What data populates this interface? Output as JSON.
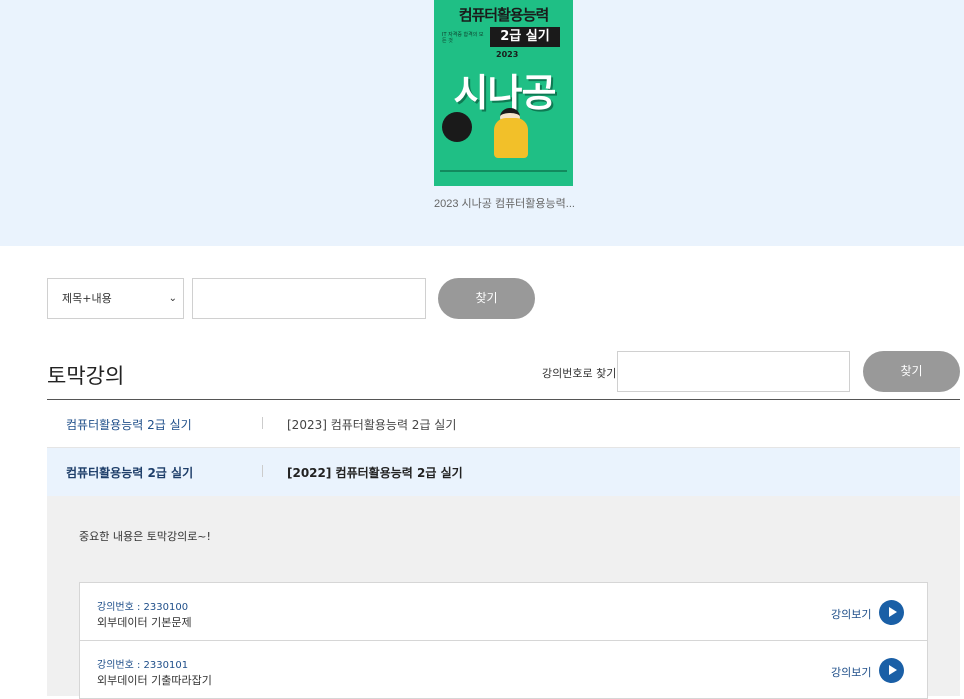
{
  "hero": {
    "book": {
      "title_line1": "컴퓨터활용능력",
      "title_line2": "2급 실기",
      "brand": "시나공",
      "year": "2023",
      "blurb": "IT 자격증 합격의 모든 것",
      "caption": "2023 시나공 컴퓨터활용능력..."
    }
  },
  "search": {
    "select_value": "제목+내용",
    "input_value": "",
    "button_label": "찾기"
  },
  "section": {
    "title": "토막강의",
    "lecno_label": "강의번호로 찾기",
    "lecno_value": "",
    "button_label": "찾기"
  },
  "courses": [
    {
      "category": "컴퓨터활용능력 2급 실기",
      "name": "[2023] 컴퓨터활용능력 2급 실기"
    },
    {
      "category": "컴퓨터활용능력 2급 실기",
      "name": "[2022] 컴퓨터활용능력 2급 실기"
    }
  ],
  "panel": {
    "intro": "중요한 내용은 토막강의로~!",
    "lectures": [
      {
        "number": "강의번호 : 2330100",
        "title": "외부데이터 기본문제",
        "view_label": "강의보기"
      },
      {
        "number": "강의번호 : 2330101",
        "title": "외부데이터 기출따라잡기",
        "view_label": "강의보기"
      }
    ]
  },
  "colors": {
    "hero_bg": "#eaf3fd",
    "book_cover": "#1fbf85",
    "button_gray": "#999999",
    "accent_blue": "#1a5fa6",
    "panel_bg": "#f0f0f0"
  },
  "icons": {
    "select_chevron": "chevron-down-icon",
    "play": "play-circle-icon"
  }
}
